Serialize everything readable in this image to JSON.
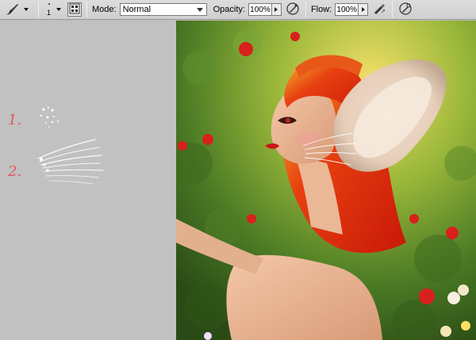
{
  "options_bar": {
    "brush_size": "1",
    "mode_label": "Mode:",
    "mode_value": "Normal",
    "opacity_label": "Opacity:",
    "opacity_value": "100%",
    "flow_label": "Flow:",
    "flow_value": "100%"
  },
  "annotations": {
    "step_1": "1.",
    "step_2": "2."
  },
  "icons": [
    "brush-tool-icon",
    "brush-panel-icon",
    "airbrush-icon",
    "pressure-opacity-icon",
    "pressure-size-icon"
  ],
  "colors": {
    "annotation": "#e2555f",
    "toolbar_bg": "#d6d6d6",
    "canvas_gray": "#c1c1c1"
  }
}
